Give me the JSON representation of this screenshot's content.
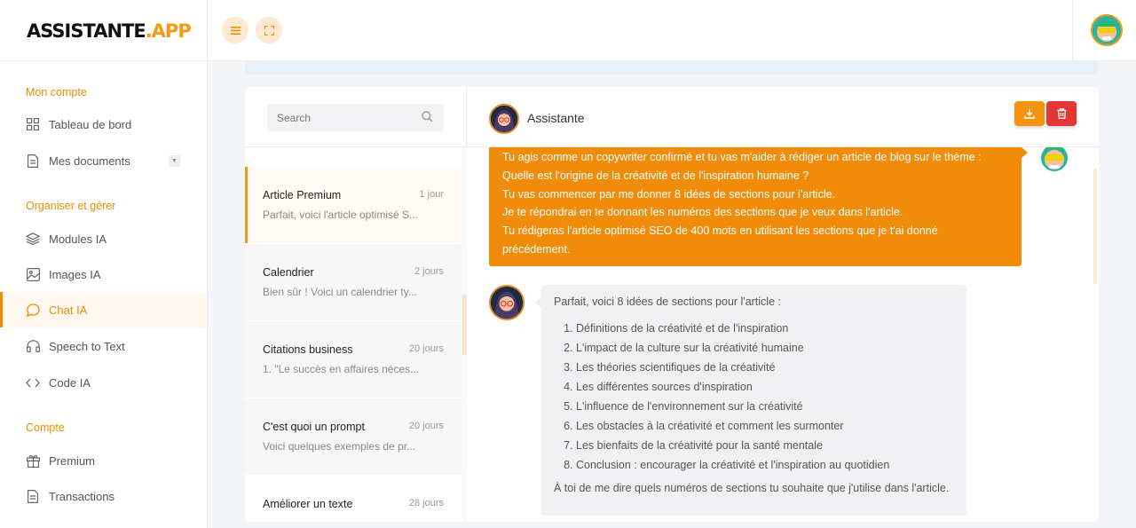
{
  "brand": {
    "name_main": "ASSISTANTE",
    "name_accent": ".APP"
  },
  "header": {
    "menu_icon": "menu-icon",
    "fullscreen_icon": "fullscreen-icon"
  },
  "sidebar": {
    "sections": [
      {
        "title": "Mon compte",
        "items": [
          {
            "label": "Tableau de bord",
            "icon": "grid-icon"
          },
          {
            "label": "Mes documents",
            "icon": "document-icon",
            "has_dropdown": true
          }
        ]
      },
      {
        "title": "Organiser et gérer",
        "items": [
          {
            "label": "Modules IA",
            "icon": "layers-icon"
          },
          {
            "label": "Images IA",
            "icon": "image-icon"
          },
          {
            "label": "Chat IA",
            "icon": "chat-icon",
            "active": true
          },
          {
            "label": "Speech to Text",
            "icon": "headphones-icon"
          },
          {
            "label": "Code IA",
            "icon": "code-icon"
          }
        ]
      },
      {
        "title": "Compte",
        "items": [
          {
            "label": "Premium",
            "icon": "gift-icon"
          },
          {
            "label": "Transactions",
            "icon": "receipt-icon"
          }
        ]
      }
    ]
  },
  "search": {
    "placeholder": "Search"
  },
  "conversations": [
    {
      "title": "Article Premium",
      "date": "1 jour",
      "preview": "Parfait, voici l'article optimisé S...",
      "active": true
    },
    {
      "title": "Calendrier",
      "date": "2 jours",
      "preview": "Bien sûr ! Voici un calendrier ty..."
    },
    {
      "title": "Citations business",
      "date": "20 jours",
      "preview": "1. \"Le succès en affaires néces..."
    },
    {
      "title": "C'est quoi un prompt",
      "date": "20 jours",
      "preview": "Voici quelques exemples de pr..."
    },
    {
      "title": "Améliorer un texte",
      "date": "28 jours",
      "preview": ""
    }
  ],
  "chat": {
    "assistant_name": "Assistante",
    "user_message_lines": [
      "Tu agis comme un copywriter confirmé et tu vas m'aider à rédiger un article de blog sur le thème :",
      "Quelle est l'origine de la créativité et de l'inspiration humaine ?",
      "Tu vas commencer par me donner 8 idées de sections pour l'article.",
      "Je te répondrai en te donnant les numéros des sections que je veux dans l'article.",
      "Tu rédigeras l'article optimisé SEO de 400 mots en utilisant les sections que je t'ai donné précédement."
    ],
    "bot_reply": {
      "intro": "Parfait, voici 8 idées de sections pour l'article :",
      "items": [
        "Définitions de la créativité et de l'inspiration",
        "L'impact de la culture sur la créativité humaine",
        "Les théories scientifiques de la créativité",
        "Les différentes sources d'inspiration",
        "L'influence de l'environnement sur la créativité",
        "Les obstacles à la créativité et comment les surmonter",
        "Les bienfaits de la créativité pour la santé mentale",
        "Conclusion : encourager la créativité et l'inspiration au quotidien"
      ],
      "outro": "À toi de me dire quels numéros de sections tu souhaite que j'utilise dans l'article."
    }
  },
  "colors": {
    "accent": "#f08c00",
    "danger": "#e63535",
    "user_bubble": "#f18c0a"
  }
}
